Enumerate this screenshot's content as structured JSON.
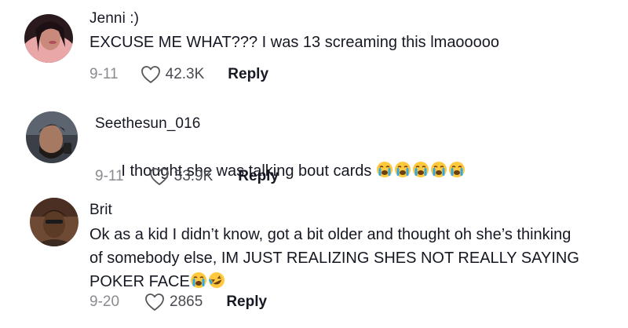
{
  "comments": [
    {
      "username": "Jenni :)",
      "text": "EXCUSE ME WHAT??? I was 13 screaming this lmaooooo",
      "emojis": [],
      "date": "9-11",
      "likes": "42.3K",
      "reply_label": "Reply"
    },
    {
      "username": "Seethesun_016",
      "text": "I thought she was talking bout cards ",
      "emojis": [
        "loudly-crying-face",
        "loudly-crying-face",
        "loudly-crying-face",
        "loudly-crying-face",
        "loudly-crying-face"
      ],
      "date": "9-11",
      "likes": "33.9K",
      "reply_label": "Reply"
    },
    {
      "username": "Brit",
      "text_lines": [
        "Ok as a kid I didn’t know, got a bit older and thought oh she’s thinking",
        "of somebody else, IM JUST REALIZING SHES NOT REALLY SAYING",
        "POKER FACE"
      ],
      "emojis": [
        "loudly-crying-face",
        "rolling-on-floor-laughing"
      ],
      "date": "9-20",
      "likes": "2865",
      "reply_label": "Reply"
    }
  ],
  "colors": {
    "text": "#161823",
    "secondary": "#8a8b91",
    "emoji_face": "#ffc83d",
    "tears": "#2ea8e8"
  }
}
